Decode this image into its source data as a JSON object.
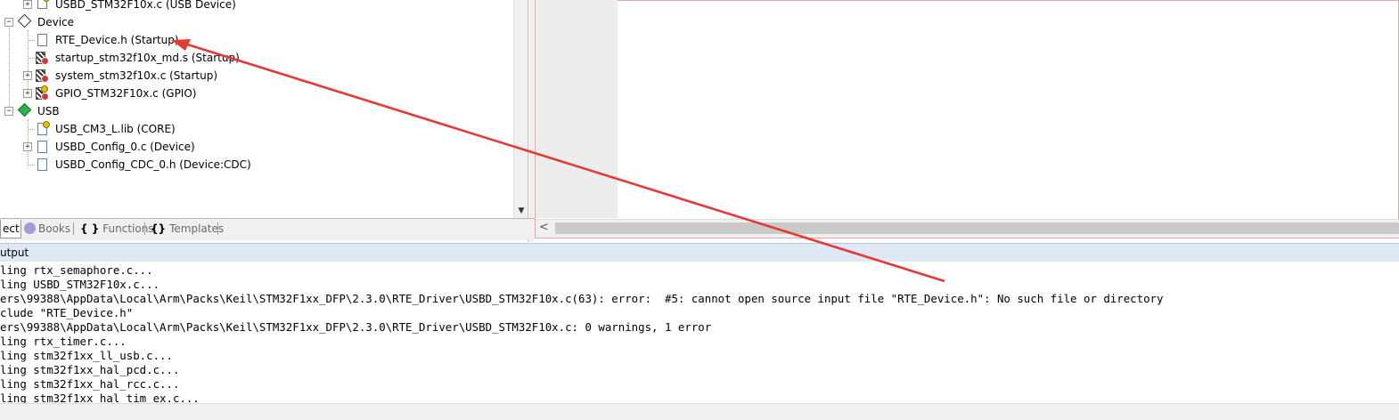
{
  "project_tree": {
    "items": [
      {
        "label": "USBD_STM32F10x.c (USB Device)"
      },
      {
        "label": "Device"
      },
      {
        "label": "RTE_Device.h (Startup)"
      },
      {
        "label": "startup_stm32f10x_md.s (Startup)"
      },
      {
        "label": "system_stm32f10x.c (Startup)"
      },
      {
        "label": "GPIO_STM32F10x.c (GPIO)"
      },
      {
        "label": "USB"
      },
      {
        "label": "USB_CM3_L.lib (CORE)"
      },
      {
        "label": "USBD_Config_0.c (Device)"
      },
      {
        "label": "USBD_Config_CDC_0.h (Device:CDC)"
      }
    ],
    "expanders": {
      "collapsed": "+",
      "expanded": "−"
    }
  },
  "tabs": [
    {
      "label": "ect"
    },
    {
      "label": "Books"
    },
    {
      "label": "{ }",
      "extra": "Functions"
    },
    {
      "label": "{}",
      "extra": "Templates"
    }
  ],
  "output": {
    "title": "utput",
    "lines": [
      "ling rtx_semaphore.c...",
      "ling USBD_STM32F10x.c...",
      "ers\\99388\\AppData\\Local\\Arm\\Packs\\Keil\\STM32F1xx_DFP\\2.3.0\\RTE_Driver\\USBD_STM32F10x.c(63): error:  #5: cannot open source input file \"RTE_Device.h\": No such file or directory",
      "clude \"RTE_Device.h\"",
      "ers\\99388\\AppData\\Local\\Arm\\Packs\\Keil\\STM32F1xx_DFP\\2.3.0\\RTE_Driver\\USBD_STM32F10x.c: 0 warnings, 1 error",
      "ling rtx_timer.c...",
      "ling stm32f1xx_ll_usb.c...",
      "ling stm32f1xx_hal_pcd.c...",
      "ling stm32f1xx_hal_rcc.c...",
      "ling stm32f1xx hal tim ex.c..."
    ]
  },
  "scroll": {
    "down_arrow": "▼",
    "left_arrow": "<"
  },
  "colors": {
    "annotation_arrow": "#e53935",
    "output_header_bg": "#dfe8f5",
    "editor_border": "#e6a6a6"
  }
}
